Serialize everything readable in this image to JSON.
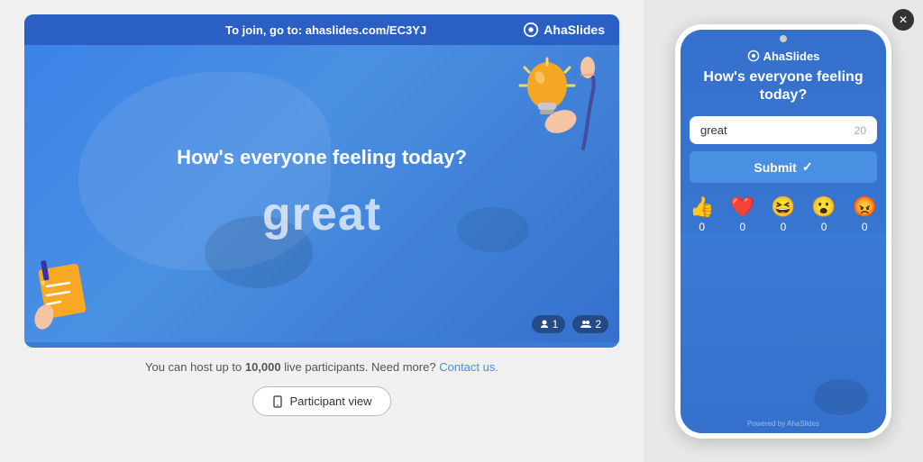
{
  "slide": {
    "join_prefix": "To join, go to: ",
    "join_url": "ahaslides.com/EC3YJ",
    "brand": "AhaSlides",
    "question": "How's everyone feeling today?",
    "answer": "great",
    "participant_icon_count": "1",
    "people_icon_count": "2"
  },
  "info": {
    "text_before": "You can host up to ",
    "bold_text": "10,000",
    "text_after": " live participants. Need more?",
    "contact_link": "Contact us."
  },
  "participant_btn": {
    "label": "Participant view"
  },
  "phone": {
    "brand": "AhaSlides",
    "question": "How's everyone feeling today?",
    "input_value": "great",
    "input_count": "20",
    "submit_label": "Submit",
    "reactions": [
      {
        "emoji": "👍",
        "count": "0"
      },
      {
        "emoji": "❤️",
        "count": "0"
      },
      {
        "emoji": "😆",
        "count": "0"
      },
      {
        "emoji": "😮",
        "count": "0"
      },
      {
        "emoji": "😡",
        "count": "0"
      }
    ],
    "powered_text": "Powered by AhaSlides"
  },
  "close_btn": "✕"
}
